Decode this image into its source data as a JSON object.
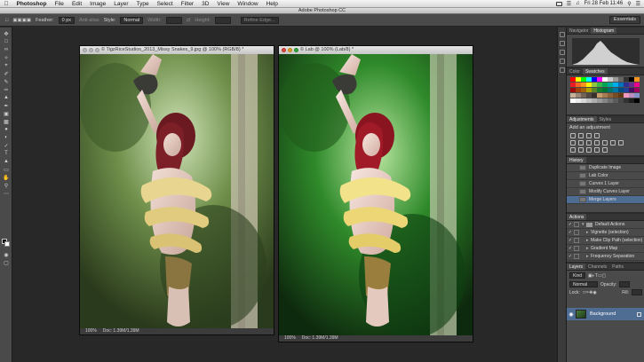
{
  "menubar": {
    "apple_icon": "",
    "items": [
      "Photoshop",
      "File",
      "Edit",
      "Image",
      "Layer",
      "Type",
      "Select",
      "Filter",
      "3D",
      "View",
      "Window",
      "Help"
    ],
    "clock": "Fri 28 Feb  11:46"
  },
  "app_title": "Adobe Photoshop CC",
  "options": {
    "feather_label": "Feather:",
    "feather_value": "0 px",
    "antialias_label": "Anti-alias",
    "style_label": "Style:",
    "style_value": "Normal",
    "width_label": "Width:",
    "height_label": "Height:",
    "refine_edge": "Refine Edge...",
    "workspace": "Essentials"
  },
  "documents": [
    {
      "title": "© TigzRiceStudios_2013_Missy Snakes_9.jpg @ 100% (RGB/8) *",
      "zoom": "100%",
      "doc_size": "Doc: 1.39M/1.39M"
    },
    {
      "title": "© Lab @ 100% (Lab/8) *",
      "zoom": "100%",
      "doc_size": "Doc: 1.39M/1.39M"
    }
  ],
  "panels": {
    "navigator_tabs": [
      "Navigator",
      "Histogram"
    ],
    "color_tabs": [
      "Color",
      "Swatches"
    ],
    "adjustments_tabs": [
      "Adjustments",
      "Styles"
    ],
    "adjustments_label": "Add an adjustment",
    "history_tab": "History",
    "history_items": [
      "Duplicate Image",
      "Lab Color",
      "Curves 1 Layer",
      "Modify Curves Layer",
      "Merge Layers"
    ],
    "actions_tab": "Actions",
    "actions_items": [
      "Default Actions",
      "Vignette (selection)",
      "Make Clip Path (selection)",
      "Gradient Map",
      "Frequency Separation"
    ],
    "layers_tabs": [
      "Layers",
      "Channels",
      "Paths"
    ],
    "layers_kind": "Kind",
    "blend_mode": "Normal",
    "opacity_label": "Opacity:",
    "lock_label": "Lock:",
    "fill_label": "Fill:",
    "layer_name": "Background"
  },
  "colors": {
    "accent_selected": "#4f6c93",
    "panel_bg": "#4a4a4a",
    "canvas_bg": "#282828"
  }
}
